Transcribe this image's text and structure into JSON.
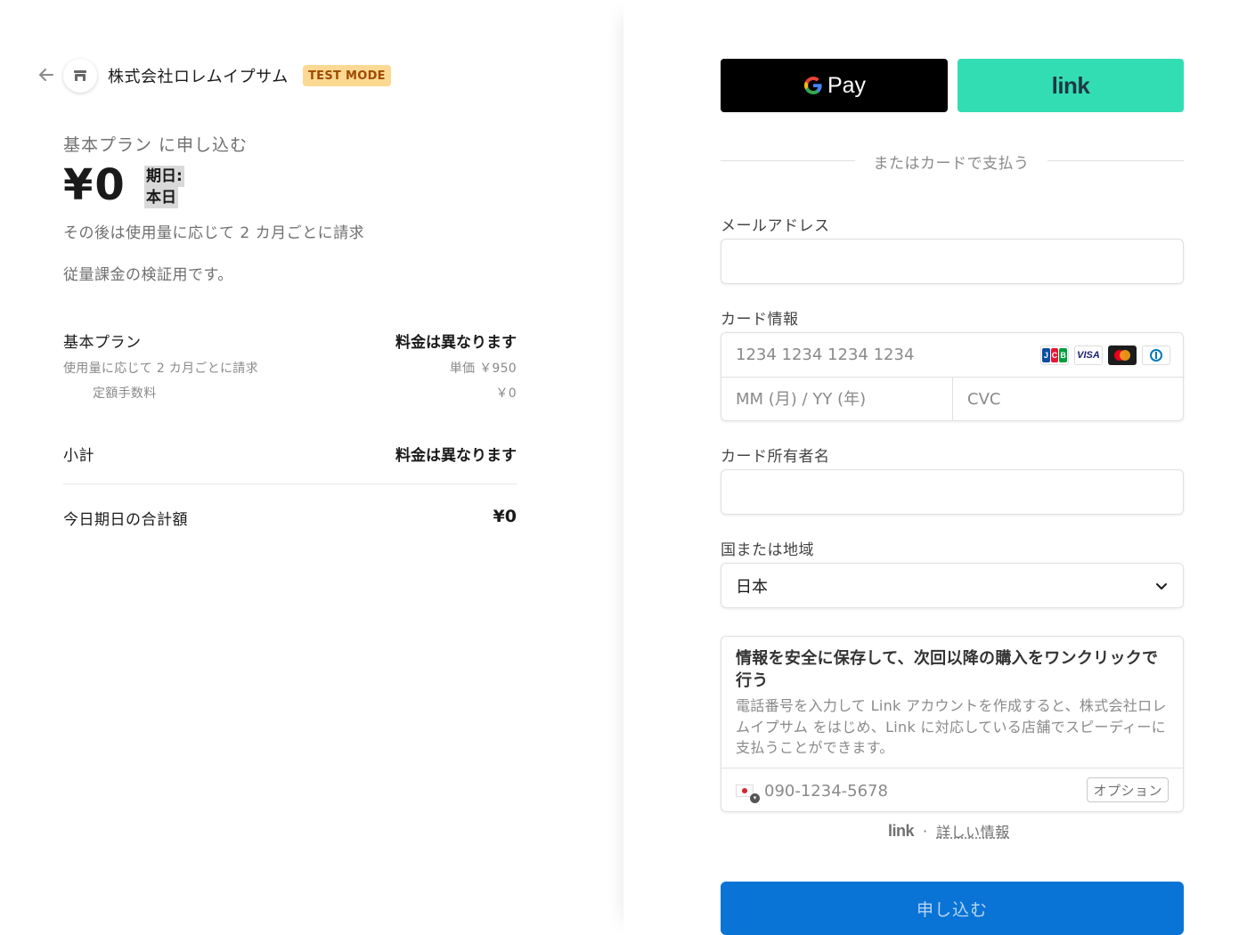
{
  "header": {
    "merchant_name": "株式会社ロレムイプサム",
    "test_badge": "TEST MODE",
    "icons": {
      "back": "arrow-left-icon",
      "store": "store-icon"
    }
  },
  "summary": {
    "plan_subscribe": "基本プラン に申し込む",
    "price": "¥0",
    "due_label": "期日:",
    "due_value": "本日",
    "billing_note": "その後は使用量に応じて 2 カ月ごとに請求",
    "description": "従量課金の検証用です。",
    "line_item": {
      "name": "基本プラン",
      "price": "料金は異なります",
      "usage_note": "使用量に応じて 2 カ月ごとに請求",
      "unit_price": "単価 ￥950",
      "fixed_fee_label": "定額手数料",
      "fixed_fee_value": "￥0"
    },
    "subtotal_label": "小計",
    "subtotal_value": "料金は異なります",
    "total_label": "今日期日の合計額",
    "total_value": "¥0"
  },
  "payment": {
    "gpay_label": "Pay",
    "link_label": "link",
    "or_text": "またはカードで支払う",
    "email_label": "メールアドレス",
    "email_value": "",
    "card_label": "カード情報",
    "card_number_placeholder": "1234 1234 1234 1234",
    "card_expiry_placeholder": "MM (月) / YY (年)",
    "card_cvc_placeholder": "CVC",
    "card_brands": [
      "JCB",
      "VISA",
      "Mastercard",
      "Diners"
    ],
    "brand_colors": {
      "jcb_blue": "#0b4ea2",
      "jcb_red": "#e21836",
      "jcb_green": "#009f3c",
      "visa": "#1a1f71",
      "mc_red": "#eb001b",
      "mc_yellow": "#f79e1b",
      "diners": "#0079be"
    },
    "holder_label": "カード所有者名",
    "holder_value": "",
    "country_label": "国または地域",
    "country_value": "日本",
    "link_save_title": "情報を安全に保存して、次回以降の購入をワンクリックで行う",
    "link_save_desc": "電話番号を入力して Link アカウントを作成すると、株式会社ロレムイプサム をはじめ、Link に対応している店舗でスピーディーに支払うことができます。",
    "phone_placeholder": "090-1234-5678",
    "optional_badge": "オプション",
    "footer_logo": "link",
    "footer_sep": "·",
    "footer_more": "詳しい情報",
    "submit_label": "申し込む",
    "colors": {
      "gpay_bg": "#000000",
      "link_bg": "#33ddb3",
      "submit_bg": "#0a74d6",
      "test_badge_bg": "#fbd992"
    }
  }
}
